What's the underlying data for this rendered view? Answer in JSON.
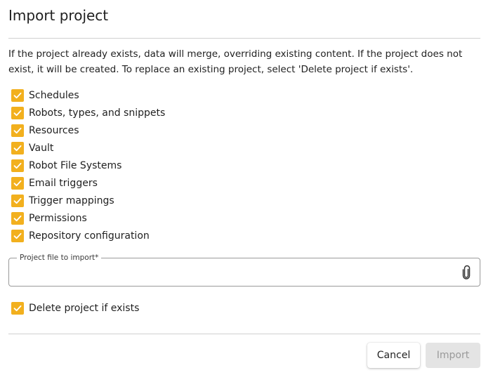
{
  "dialog": {
    "title": "Import project",
    "description": "If the project already exists, data will merge, overriding existing content. If the project does not exist, it will be created. To replace an existing project, select 'Delete project if exists'.",
    "options": [
      {
        "label": "Schedules",
        "checked": true
      },
      {
        "label": "Robots, types, and snippets",
        "checked": true
      },
      {
        "label": "Resources",
        "checked": true
      },
      {
        "label": "Vault",
        "checked": true
      },
      {
        "label": "Robot File Systems",
        "checked": true
      },
      {
        "label": "Email triggers",
        "checked": true
      },
      {
        "label": "Trigger mappings",
        "checked": true
      },
      {
        "label": "Permissions",
        "checked": true
      },
      {
        "label": "Repository configuration",
        "checked": true
      }
    ],
    "file_field": {
      "label": "Project file to import*",
      "value": "",
      "icon": "paperclip-icon"
    },
    "delete_option": {
      "label": "Delete project if exists",
      "checked": true
    },
    "buttons": {
      "cancel_label": "Cancel",
      "import_label": "Import",
      "import_disabled": true
    }
  },
  "colors": {
    "checkbox_accent": "#f2b01e",
    "divider": "#d0d0d0",
    "disabled_button_bg": "#e4e4e4",
    "disabled_button_text": "#9a9a9a"
  }
}
